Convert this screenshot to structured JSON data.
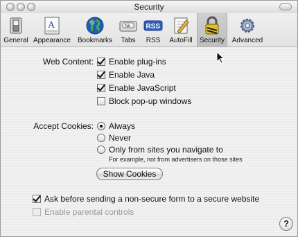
{
  "window": {
    "title": "Security"
  },
  "toolbar": {
    "items": [
      {
        "label": "General",
        "icon": "general-switch-icon"
      },
      {
        "label": "Appearance",
        "icon": "appearance-icon"
      },
      {
        "label": "Bookmarks",
        "icon": "globe-icon"
      },
      {
        "label": "Tabs",
        "icon": "tabs-icon"
      },
      {
        "label": "RSS",
        "icon": "rss-icon"
      },
      {
        "label": "AutoFill",
        "icon": "autofill-pencil-icon"
      },
      {
        "label": "Security",
        "icon": "lock-icon",
        "selected": true
      },
      {
        "label": "Advanced",
        "icon": "gear-icon"
      }
    ]
  },
  "web_content": {
    "label": "Web Content:",
    "options": [
      {
        "label": "Enable plug-ins",
        "checked": true
      },
      {
        "label": "Enable Java",
        "checked": true
      },
      {
        "label": "Enable JavaScript",
        "checked": true
      },
      {
        "label": "Block pop-up windows",
        "checked": false
      }
    ]
  },
  "cookies": {
    "label": "Accept Cookies:",
    "options": [
      {
        "label": "Always",
        "selected": true
      },
      {
        "label": "Never",
        "selected": false
      },
      {
        "label": "Only from sites you navigate to",
        "selected": false
      }
    ],
    "hint": "For example, not from advertisers on those sites",
    "show_button": "Show Cookies"
  },
  "bottom": {
    "ask_before": {
      "label": "Ask before sending a non-secure form to a secure website",
      "checked": true
    },
    "parental": {
      "label": "Enable parental controls",
      "checked": false,
      "disabled": true
    }
  },
  "help": {
    "label": "?"
  },
  "colors": {
    "rss_blue": "#2f5db8",
    "globe_blue": "#1e5fb3",
    "lock_yellow": "#e0c21a"
  }
}
